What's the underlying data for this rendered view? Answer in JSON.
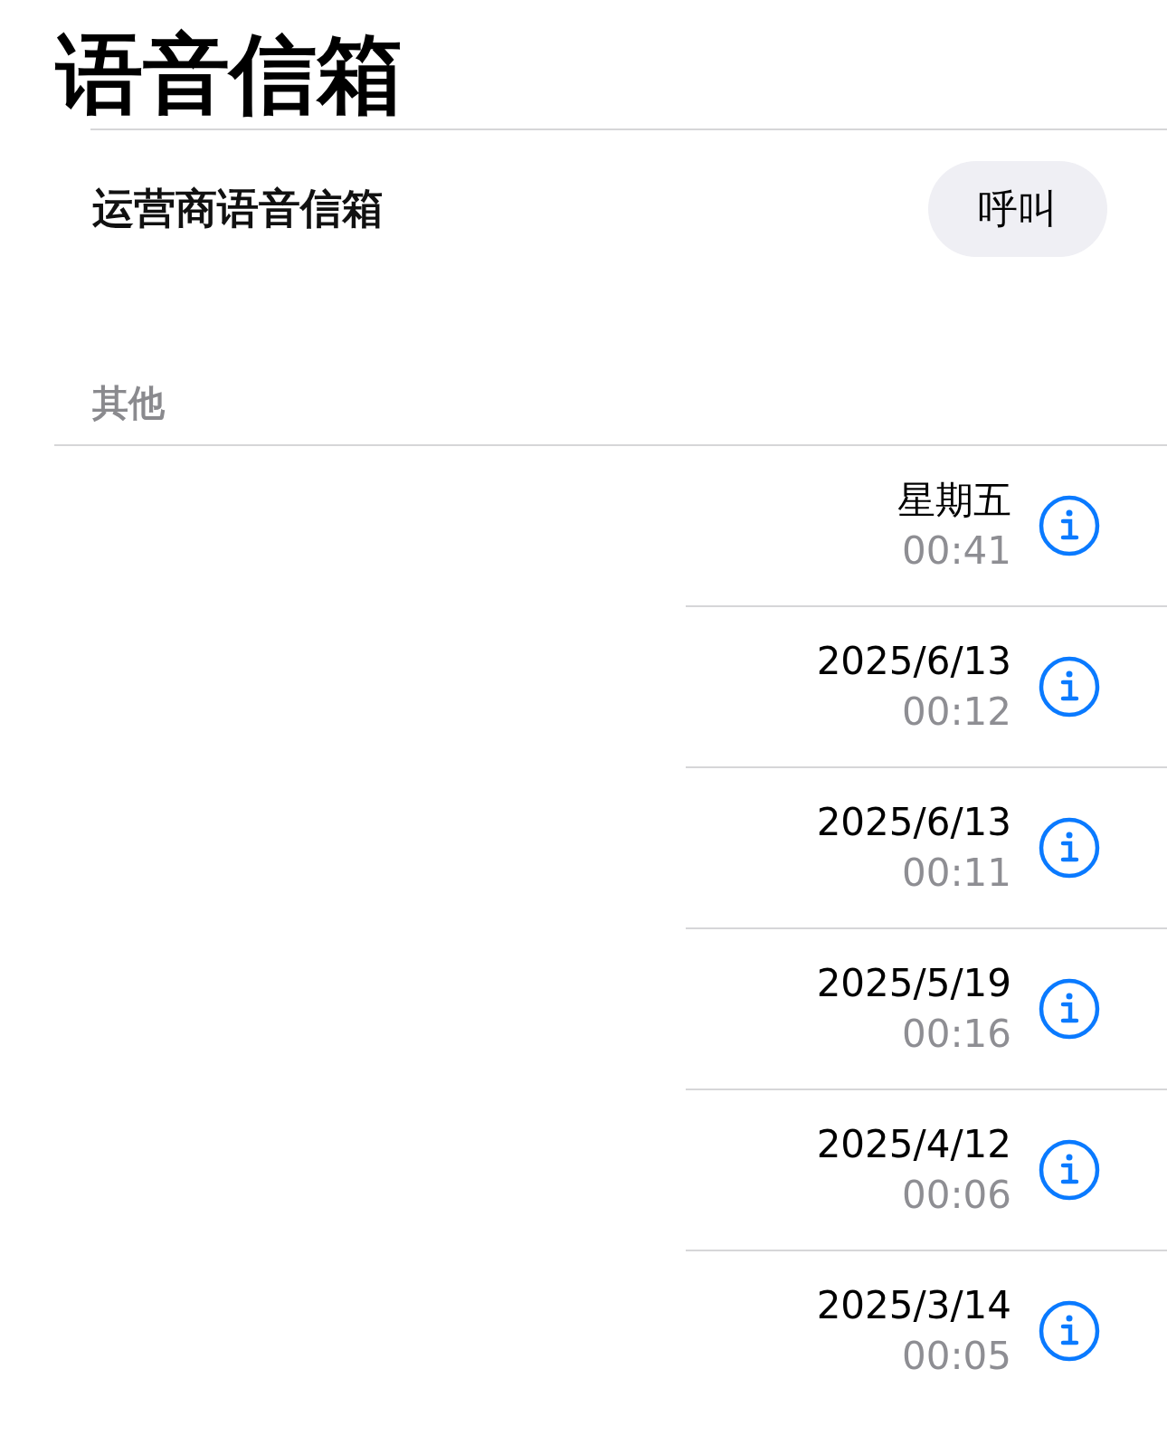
{
  "title": "语音信箱",
  "carrier": {
    "label": "运营商语音信箱",
    "button": "呼叫"
  },
  "section": {
    "header": "其他"
  },
  "messages": [
    {
      "date": "星期五",
      "duration": "00:41"
    },
    {
      "date": "2025/6/13",
      "duration": "00:12"
    },
    {
      "date": "2025/6/13",
      "duration": "00:11"
    },
    {
      "date": "2025/5/19",
      "duration": "00:16"
    },
    {
      "date": "2025/4/12",
      "duration": "00:06"
    },
    {
      "date": "2025/3/14",
      "duration": "00:05"
    }
  ]
}
